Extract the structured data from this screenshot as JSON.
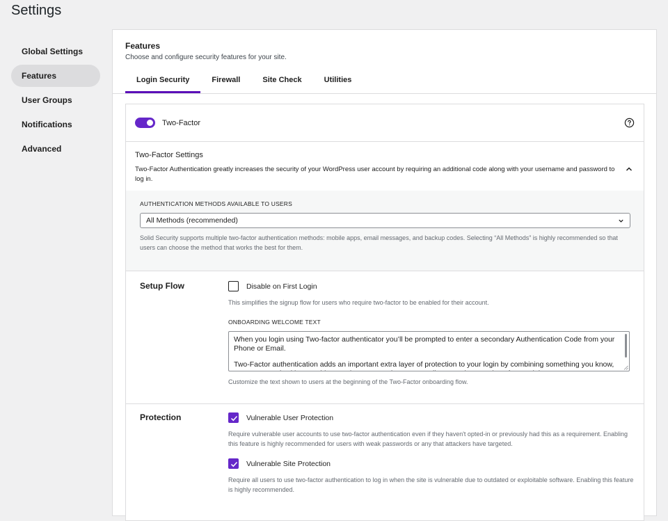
{
  "page": {
    "title": "Settings"
  },
  "sidebar": {
    "items": [
      {
        "label": "Global Settings"
      },
      {
        "label": "Features"
      },
      {
        "label": "User Groups"
      },
      {
        "label": "Notifications"
      },
      {
        "label": "Advanced"
      }
    ],
    "active": "Features"
  },
  "panel": {
    "title": "Features",
    "subtitle": "Choose and configure security features for your site.",
    "tabs": [
      {
        "label": "Login Security"
      },
      {
        "label": "Firewall"
      },
      {
        "label": "Site Check"
      },
      {
        "label": "Utilities"
      }
    ],
    "active_tab": "Login Security"
  },
  "two_factor": {
    "toggle_label": "Two-Factor",
    "toggle_on": true,
    "settings_title": "Two-Factor Settings",
    "settings_desc": "Two-Factor Authentication greatly increases the security of your WordPress user account by requiring an additional code along with your username and password to log in.",
    "methods_label": "Authentication Methods Available to Users",
    "methods_value": "All Methods (recommended)",
    "methods_help": "Solid Security supports multiple two-factor authentication methods: mobile apps, email messages, and backup codes. Selecting “All Methods” is highly recommended so that users can choose the method that works the best for them."
  },
  "setup_flow": {
    "label": "Setup Flow",
    "checkbox_label": "Disable on First Login",
    "checked": false,
    "help": "This simplifies the signup flow for users who require two-factor to be enabled for their account.",
    "onboarding_label": "Onboarding Welcome Text",
    "onboarding_p1": "When you login using Two-factor authenticator you’ll be prompted to enter a secondary Authentication Code from your Phone or Email.",
    "onboarding_p2": "Two-Factor authentication adds an important extra layer of protection to your login by combining something you know, your password, with something you have, your Phone or Email, preventing attackers from gaining access to your account even if you lose control of your password.",
    "onboarding_help": "Customize the text shown to users at the beginning of the Two-Factor onboarding flow."
  },
  "protection": {
    "label": "Protection",
    "user_label": "Vulnerable User Protection",
    "user_checked": true,
    "user_help": "Require vulnerable user accounts to use two-factor authentication even if they haven't opted-in or previously had this as a requirement. Enabling this feature is highly recommended for users with weak passwords or any that attackers have targeted.",
    "site_label": "Vulnerable Site Protection",
    "site_checked": true,
    "site_help": "Require all users to use two-factor authentication to log in when the site is vulnerable due to outdated or exploitable software. Enabling this feature is highly recommended."
  },
  "colors": {
    "accent": "#6527c9",
    "tab_underline": "#5b0fb8"
  },
  "icons": [
    "help-icon",
    "chevron-up-icon",
    "chevron-down-icon",
    "checkmark-icon"
  ]
}
